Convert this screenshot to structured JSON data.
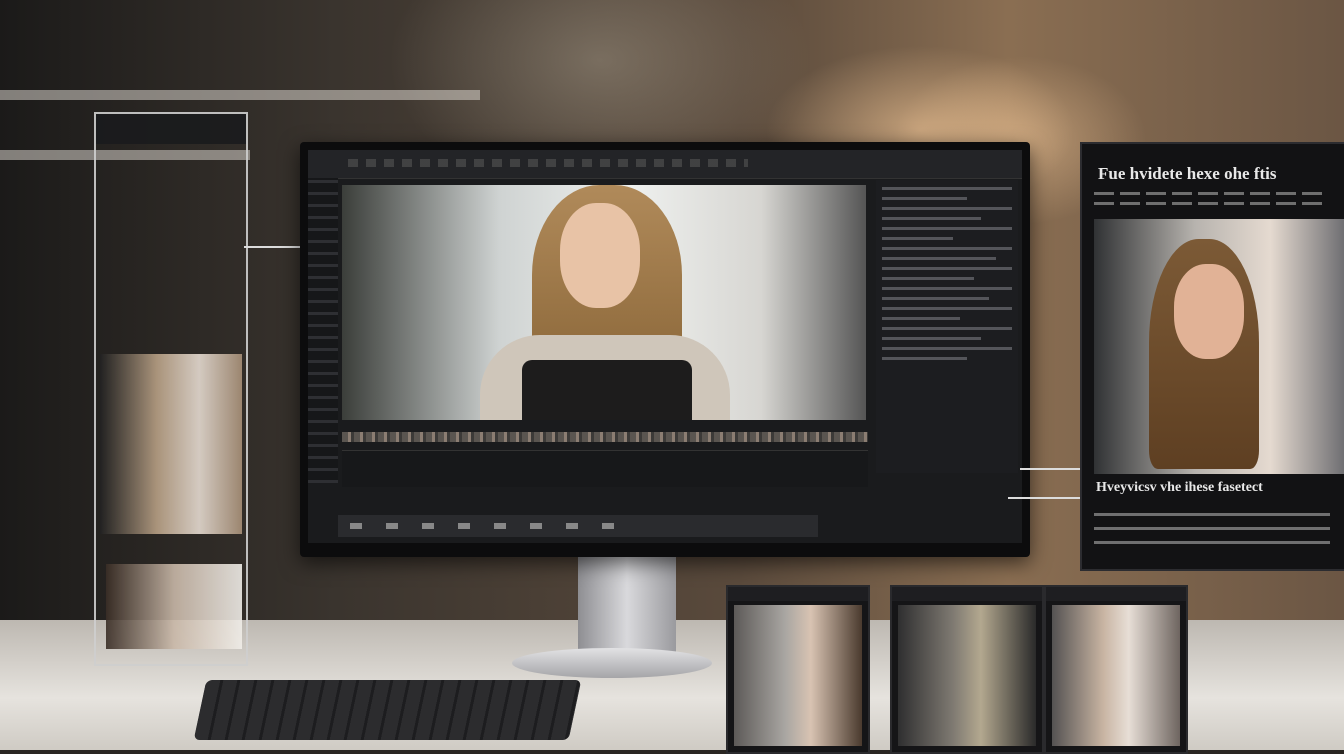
{
  "scene": {
    "description_only_visual": true
  },
  "right_card": {
    "title": "Fue hvidete hexe ohe ftis",
    "caption": "Hveyvicsv vhe ihese fasetect"
  },
  "colors": {
    "monitor_frame": "#0c0c0d",
    "screen_bg": "#1a1b1d",
    "overlay_line": "#dcdcdc",
    "wood_wall": "#8a6e52"
  }
}
